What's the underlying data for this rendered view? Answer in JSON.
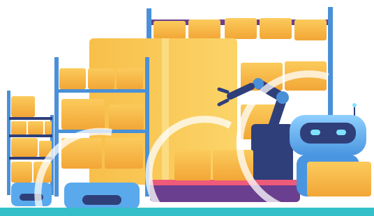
{
  "illustration": {
    "subject": "warehouse-automation",
    "colors": {
      "background": "#ffffff",
      "shelf_post": "#4a90d8",
      "shelf_post_light": "#6fb3ec",
      "shelf_back": "#e8f2fb",
      "box_main": "#f6b23c",
      "box_light": "#fbcb5c",
      "box_shadow": "#e4952a",
      "robot_blue": "#5aa9ec",
      "robot_dark": "#2f3f7a",
      "robot_eye": "#7fe3ff",
      "conveyor": "#6b3f8f",
      "conveyor_top": "#ee5a7a",
      "floor": "#35c0c9"
    }
  }
}
